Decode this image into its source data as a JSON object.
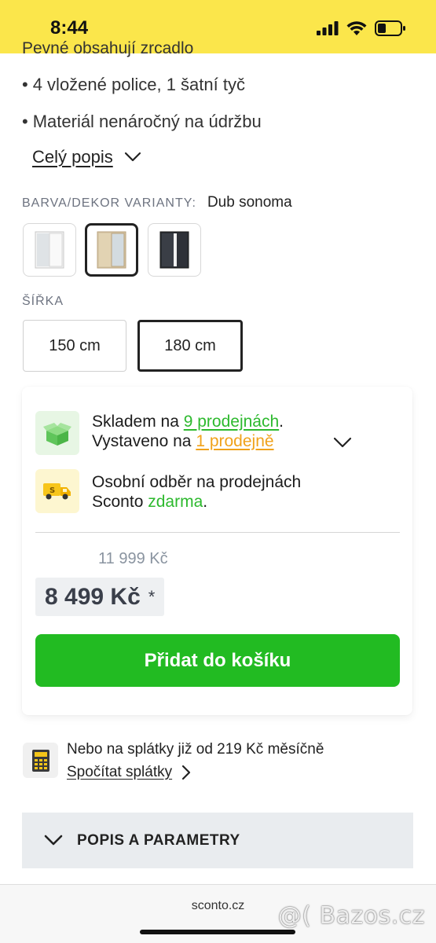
{
  "status_bar": {
    "time": "8:44"
  },
  "features": {
    "partial": "Pevné obsahují zrcadlo",
    "items": [
      "4 vložené police, 1 šatní tyč",
      "Materiál nenáročný na údržbu"
    ],
    "full_description": "Celý popis"
  },
  "variant": {
    "label": "BARVA/DEKOR VARIANTY:",
    "value": "Dub sonoma",
    "swatches": [
      "white-mirror",
      "oak-sonoma-mirror",
      "black-white"
    ]
  },
  "width": {
    "label": "ŠÍŘKA",
    "options": [
      "150 cm",
      "180 cm"
    ],
    "selected": "180 cm"
  },
  "availability": {
    "stock_prefix": "Skladem na ",
    "stock_link": "9 prodejnách",
    "stock_suffix": ".",
    "display_prefix": "Vystaveno na ",
    "display_link": "1 prodejně",
    "pickup_line1": "Osobní odběr na prodejnách",
    "pickup_prefix": "Sconto ",
    "pickup_free": "zdarma",
    "pickup_suffix": "."
  },
  "pricing": {
    "old_price": "11 999 Kč",
    "price": "8 499 Kč",
    "asterisk": "*"
  },
  "cart": {
    "add_label": "Přidat do košíku"
  },
  "installments": {
    "text": "Nebo na splátky již od 219 Kč měsíčně",
    "link": "Spočítat splátky"
  },
  "accordion": {
    "label": "POPIS A PARAMETRY"
  },
  "browser": {
    "domain": "sconto.cz"
  },
  "watermark": "@( Bazos.cz",
  "colors": {
    "status_bar": "#fbe64b",
    "accent_green": "#22bb22",
    "link_orange": "#f0a21a"
  }
}
